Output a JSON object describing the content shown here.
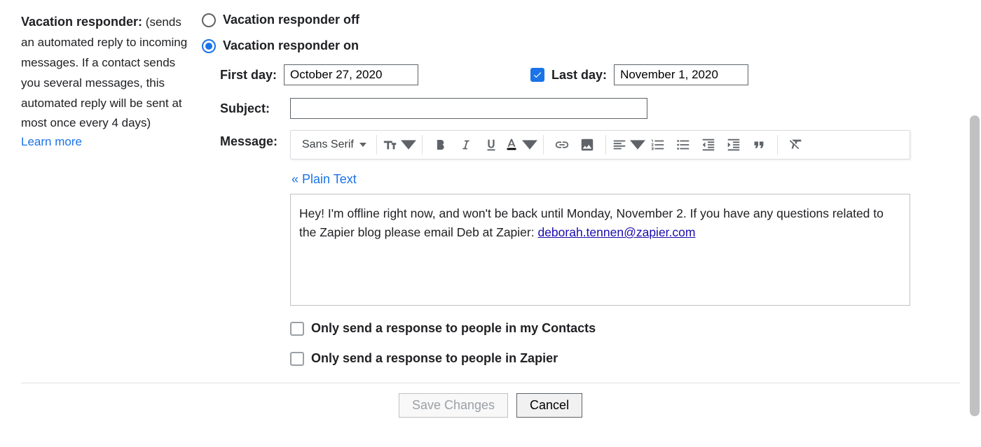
{
  "left": {
    "title": "Vacation responder:",
    "desc": "(sends an automated reply to incoming messages. If a contact sends you several messages, this automated reply will be sent at most once every 4 days)",
    "learn_more": "Learn more"
  },
  "radios": {
    "off": "Vacation responder off",
    "on": "Vacation responder on"
  },
  "dates": {
    "first_label": "First day:",
    "first_value": "October 27, 2020",
    "last_label": "Last day:",
    "last_value": "November 1, 2020"
  },
  "subject": {
    "label": "Subject:",
    "value": ""
  },
  "message": {
    "label": "Message:",
    "font_name": "Sans Serif",
    "plain_text": "« Plain Text",
    "body_text": "Hey! I'm offline right now, and won't be back until Monday, November 2. If you have any questions related to the Zapier blog please email Deb at Zapier: ",
    "body_link": "deborah.tennen@zapier.com"
  },
  "checks": {
    "contacts": "Only send a response to people in my Contacts",
    "org": "Only send a response to people in Zapier"
  },
  "footer": {
    "save": "Save Changes",
    "cancel": "Cancel"
  }
}
